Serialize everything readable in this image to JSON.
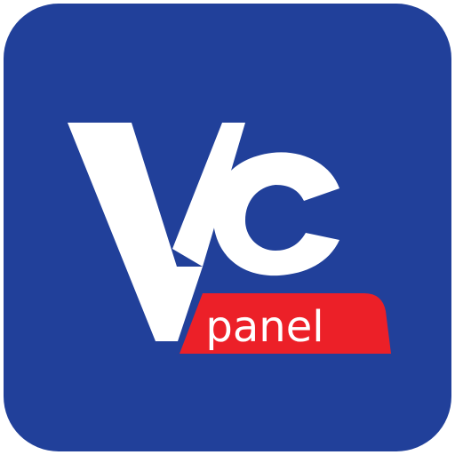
{
  "app_icon": {
    "logo_mark": "Vc",
    "logo_text": "panel",
    "colors": {
      "background": "#21409A",
      "logo": "#FFFFFF",
      "tag": "#EC2028",
      "tag_text": "#FFFFFF"
    }
  }
}
